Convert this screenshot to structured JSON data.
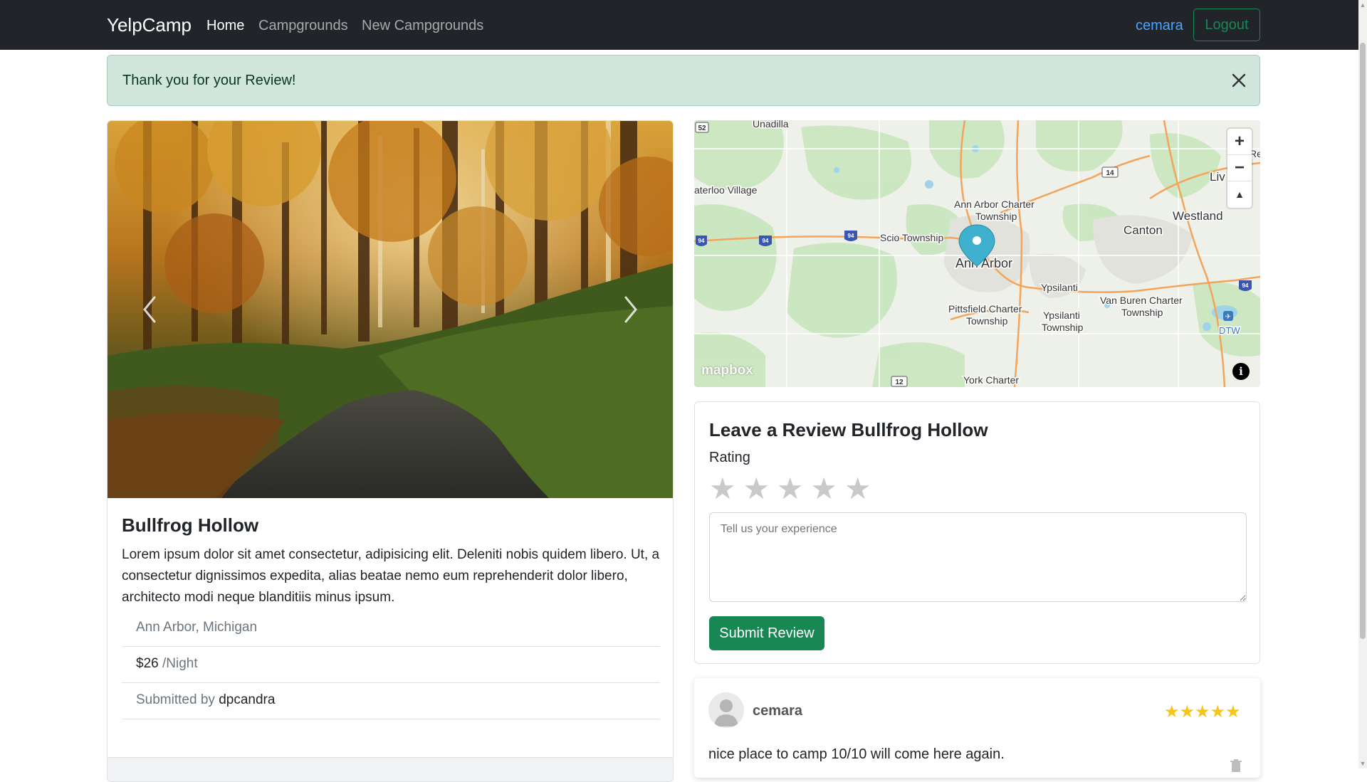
{
  "navbar": {
    "brand": "YelpCamp",
    "links": [
      "Home",
      "Campgrounds",
      "New Campgrounds"
    ],
    "active_link": "Home",
    "username": "cemara",
    "logout_label": "Logout"
  },
  "alert": {
    "message": "Thank you for your Review!",
    "close_icon": "close-icon"
  },
  "campground": {
    "title": "Bullfrog Hollow",
    "description": "Lorem ipsum dolor sit amet consectetur, adipisicing elit. Deleniti nobis quidem libero. Ut, a consectetur dignissimos expedita, alias beatae nemo eum reprehenderit dolor libero, architecto modi neque blanditiis minus ipsum.",
    "location": "Ann Arbor, Michigan",
    "price": "$26",
    "price_unit": "/Night",
    "submitted_by_label": "Submitted by",
    "author": "dpcandra"
  },
  "map": {
    "labels": {
      "unadilla": "Unadilla",
      "waterloo": "aterloo Village",
      "aa_charter": "Ann Arbor Charter",
      "township": "Township",
      "scio": "Scio Township",
      "ann_arbor": "Ann Arbor",
      "canton": "Canton",
      "westland": "Westland",
      "liv": "Liv",
      "re": "Re",
      "ypsilanti": "Ypsilanti",
      "van_buren": "Van Buren Charter",
      "pittsfield": "Pittsfield Charter",
      "ypsilanti_t": "Ypsilanti",
      "dtw": "DTW",
      "york": "York Charter"
    },
    "shields": {
      "s52": "52",
      "s14": "14",
      "s12": "12",
      "s94": "94"
    },
    "zoom_in": "+",
    "zoom_out": "−",
    "compass": "▲",
    "logo": "mapbox",
    "info": "i"
  },
  "review_form": {
    "title": "Leave a Review Bullfrog Hollow",
    "rating_label": "Rating",
    "star_glyph": "★",
    "star_count": 5,
    "placeholder": "Tell us your experience",
    "submit_label": "Submit Review"
  },
  "reviews": [
    {
      "author": "cemara",
      "rating": 5,
      "stars": "★★★★★",
      "body": "nice place to camp 10/10 will come here again."
    }
  ],
  "colors": {
    "navbar_bg": "#212529",
    "success": "#198754",
    "alert_bg": "#d1e7dd",
    "link_blue": "#4aa3ff",
    "star_gold": "#f5c518",
    "map_marker": "#3fb1ce"
  }
}
